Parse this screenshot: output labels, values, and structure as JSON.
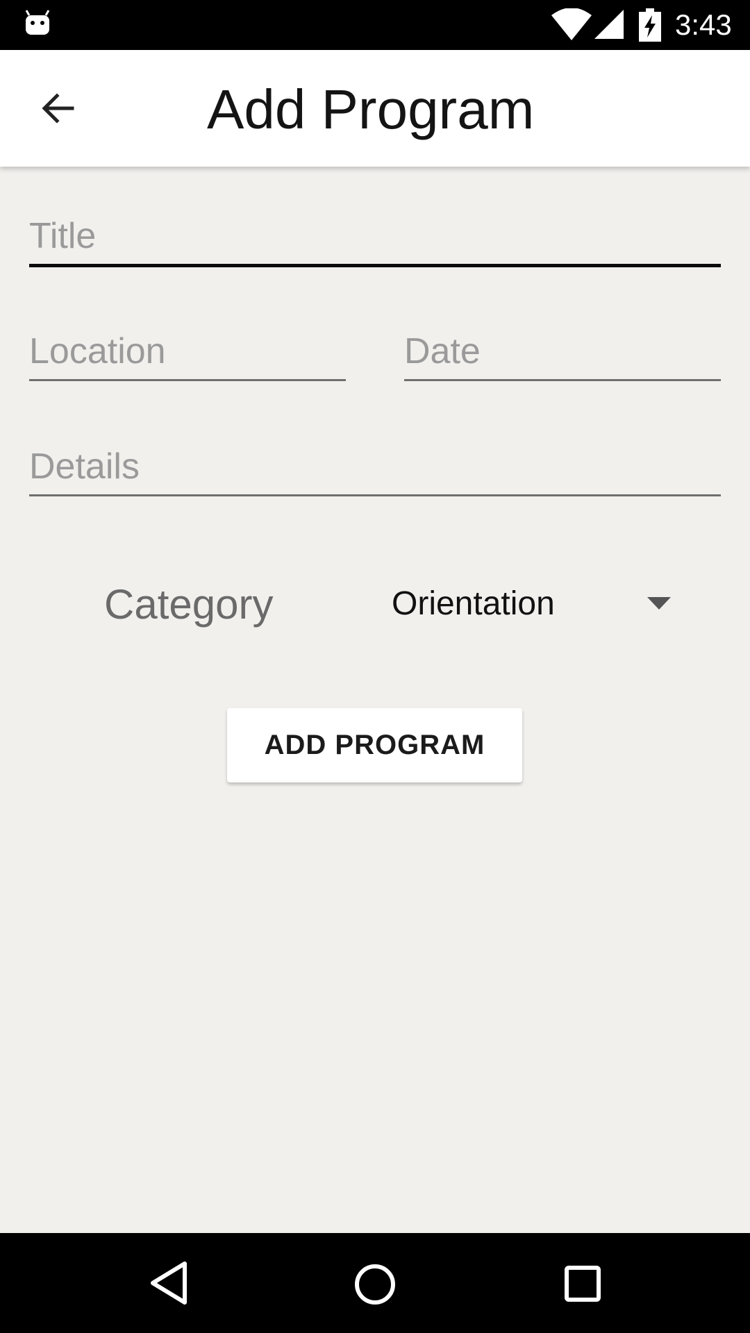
{
  "status_bar": {
    "time": "3:43",
    "icons": [
      "android-icon",
      "wifi-icon",
      "signal-icon",
      "battery-charging-icon"
    ]
  },
  "app_bar": {
    "title": "Add Program",
    "back_icon": "arrow-back-icon"
  },
  "form": {
    "title_placeholder": "Title",
    "title_value": "",
    "location_placeholder": "Location",
    "location_value": "",
    "date_placeholder": "Date",
    "date_value": "",
    "details_placeholder": "Details",
    "details_value": "",
    "category_label": "Category",
    "category_selected": "Orientation"
  },
  "actions": {
    "add_program_label": "ADD PROGRAM"
  },
  "nav_bar": {
    "icons": [
      "nav-back-icon",
      "nav-home-icon",
      "nav-recents-icon"
    ]
  },
  "colors": {
    "background": "#f1f0ed",
    "app_bar": "#ffffff",
    "system_bars": "#000000"
  }
}
